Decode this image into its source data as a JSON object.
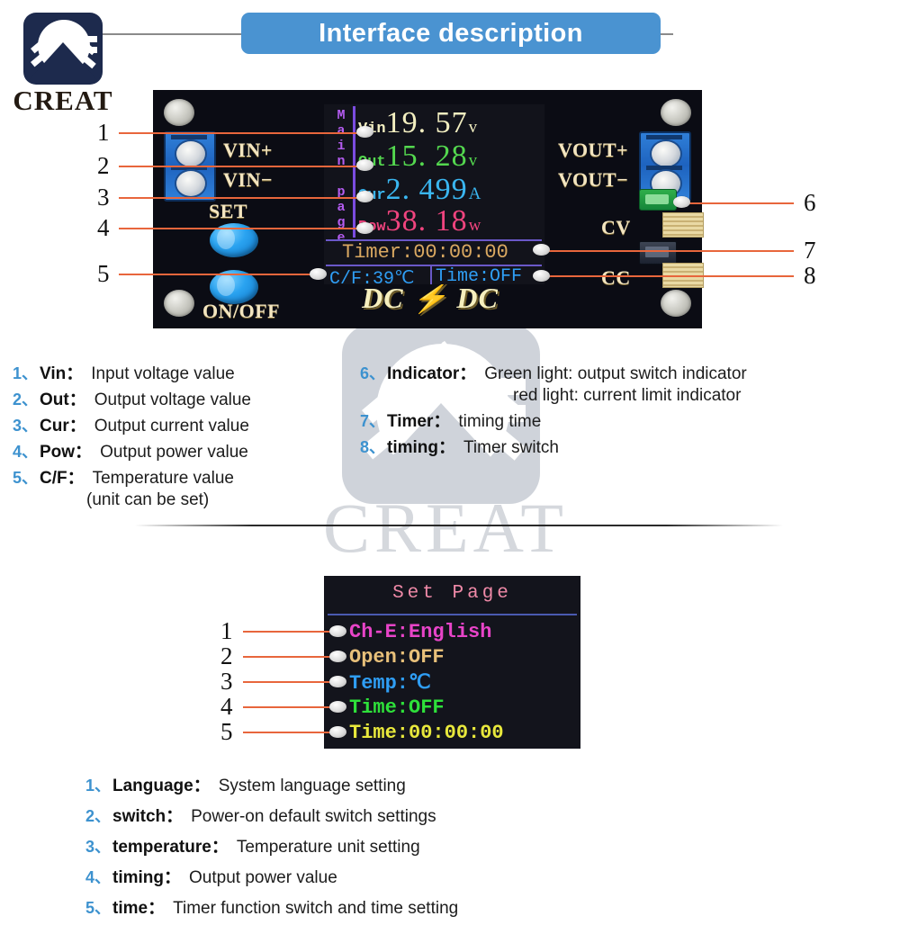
{
  "brand": {
    "name": "CREAT",
    "logo_icon": "creat-mountain-logo-icon",
    "watermark_text": "CREAT"
  },
  "header": {
    "title": "Interface description",
    "banner_color": "#4a93d1"
  },
  "device": {
    "product_logo": "DC ⚡ DC",
    "labels": {
      "vin_plus": "VIN+",
      "vin_minus": "VIN−",
      "vout_plus": "VOUT+",
      "vout_minus": "VOUT−",
      "set": "SET",
      "on_off": "ON/OFF",
      "cv": "CV",
      "cc": "CC"
    },
    "screen": {
      "side_label": "Main page",
      "side_label_chars": [
        "M",
        "a",
        "i",
        "n",
        " ",
        "p",
        "a",
        "g",
        "e"
      ],
      "side_color": "#b45cf0",
      "rows": [
        {
          "label": "Vin",
          "value": "19. 57",
          "unit": "v",
          "color": "#f2eec0"
        },
        {
          "label": "Out",
          "value": "15. 28",
          "unit": "v",
          "color": "#54d84f"
        },
        {
          "label": "Cur",
          "value": "2. 499",
          "unit": "A",
          "color": "#3ab6f0"
        },
        {
          "label": "Pow",
          "value": "38. 18",
          "unit": "w",
          "color": "#f0447e"
        }
      ],
      "timer": "Timer:00:00:00",
      "timer_color": "#d9a861",
      "temperature": "C/F:39℃",
      "time_switch": "Time:OFF",
      "status_color": "#2f9ef5"
    }
  },
  "callouts": {
    "device_left": [
      "1",
      "2",
      "3",
      "4",
      "5"
    ],
    "device_right": [
      "6",
      "7",
      "8"
    ],
    "setpage_left": [
      "1",
      "2",
      "3",
      "4",
      "5"
    ],
    "line_color": "#e8663c"
  },
  "legend_main_left": [
    {
      "num": "1、",
      "key": "Vin：",
      "val": "Input voltage value"
    },
    {
      "num": "2、",
      "key": "Out：",
      "val": "Output voltage value"
    },
    {
      "num": "3、",
      "key": "Cur：",
      "val": "Output current value"
    },
    {
      "num": "4、",
      "key": "Pow：",
      "val": "Output power value"
    },
    {
      "num": "5、",
      "key": "C/F：",
      "val": "Temperature value"
    }
  ],
  "legend_main_left_continuation": "(unit can be set)",
  "legend_main_right": [
    {
      "num": "6、",
      "key": "Indicator：",
      "val": "Green light: output switch indicator"
    },
    {
      "num": "7、",
      "key": "Timer：",
      "val": "timing time"
    },
    {
      "num": "8、",
      "key": "timing：",
      "val": "Timer switch"
    }
  ],
  "legend_main_right_continuation": "red light: current limit indicator",
  "setpage": {
    "title": "Set Page",
    "title_color": "#f08aa8",
    "items": [
      {
        "text": "Ch-E:English",
        "color": "#e844c8"
      },
      {
        "text": "Open:OFF",
        "color": "#e8c07a"
      },
      {
        "text": "Temp:℃",
        "color": "#2f9ef5"
      },
      {
        "text": "Time:OFF",
        "color": "#2ee03a"
      },
      {
        "text": "Time:00:00:00",
        "color": "#e8e83c"
      }
    ]
  },
  "legend_setpage": [
    {
      "num": "1、",
      "key": "Language：",
      "val": "System language setting"
    },
    {
      "num": "2、",
      "key": "switch：",
      "val": "Power-on default switch settings"
    },
    {
      "num": "3、",
      "key": "temperature：",
      "val": "Temperature unit setting"
    },
    {
      "num": "4、",
      "key": "timing：",
      "val": "Output power value"
    },
    {
      "num": "5、",
      "key": "time：",
      "val": "Timer function switch and time setting"
    }
  ]
}
